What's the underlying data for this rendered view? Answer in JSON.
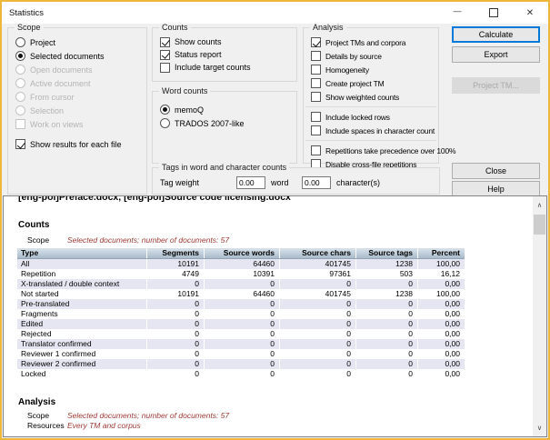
{
  "window": {
    "title": "Statistics"
  },
  "icons": {
    "minimize": "—",
    "close": "✕",
    "scroll_up": "∧",
    "scroll_down": "∨"
  },
  "colors": {
    "window_border": "#ECB73B",
    "titlebar_bg": "#FFFFFF",
    "dialog_bg": "#F0F0F0",
    "focus_border": "#0078D7",
    "table_header_top": "#D9E2EA",
    "table_header_bottom": "#A9BACA",
    "table_alt_row": "#E6E6F2",
    "scope_text_red": "#9E3B35"
  },
  "scope_group": {
    "label": "Scope",
    "options": [
      {
        "type": "radio",
        "label": "Project",
        "checked": false,
        "enabled": true
      },
      {
        "type": "radio",
        "label": "Selected documents",
        "checked": true,
        "enabled": true
      },
      {
        "type": "radio",
        "label": "Open documents",
        "checked": false,
        "enabled": false
      },
      {
        "type": "radio",
        "label": "Active document",
        "checked": false,
        "enabled": false
      },
      {
        "type": "radio",
        "label": "From cursor",
        "checked": false,
        "enabled": false
      },
      {
        "type": "radio",
        "label": "Selection",
        "checked": false,
        "enabled": false
      },
      {
        "type": "checkbox",
        "label": "Work on views",
        "checked": false,
        "enabled": false
      }
    ],
    "footer_options": [
      {
        "type": "checkbox",
        "label": "Show results for each file",
        "checked": true,
        "enabled": true
      }
    ]
  },
  "counts_group": {
    "label": "Counts",
    "items": [
      {
        "type": "checkbox",
        "label": "Show counts",
        "checked": true,
        "enabled": true
      },
      {
        "type": "checkbox",
        "label": "Status report",
        "checked": true,
        "enabled": true
      },
      {
        "type": "checkbox",
        "label": "Include target counts",
        "checked": false,
        "enabled": true
      }
    ]
  },
  "word_counts_group": {
    "label": "Word counts",
    "options": [
      {
        "type": "radio",
        "label": "memoQ",
        "checked": true,
        "enabled": true
      },
      {
        "type": "radio",
        "label": "TRADOS 2007-like",
        "checked": false,
        "enabled": true
      }
    ]
  },
  "analysis_group": {
    "label": "Analysis",
    "block1": [
      {
        "type": "checkbox",
        "label": "Project TMs and corpora",
        "checked": true,
        "enabled": true
      },
      {
        "type": "checkbox",
        "label": "Details by source",
        "checked": false,
        "enabled": true
      },
      {
        "type": "checkbox",
        "label": "Homogeneity",
        "checked": false,
        "enabled": true
      },
      {
        "type": "checkbox",
        "label": "Create project TM",
        "checked": false,
        "enabled": true
      },
      {
        "type": "checkbox",
        "label": "Show weighted counts",
        "checked": false,
        "enabled": true
      }
    ],
    "block2": [
      {
        "type": "checkbox",
        "label": "Include locked rows",
        "checked": false,
        "enabled": true
      },
      {
        "type": "checkbox",
        "label": "Include spaces in character count",
        "checked": false,
        "enabled": true
      }
    ],
    "block3": [
      {
        "type": "checkbox",
        "label": "Repetitions take precedence over 100%",
        "checked": false,
        "enabled": true
      },
      {
        "type": "checkbox",
        "label": "Disable cross-file repetitions",
        "checked": false,
        "enabled": true
      }
    ]
  },
  "tags_group": {
    "label": "Tags in word and character counts",
    "tag_weight_label": "Tag weight",
    "word_value": "0.00",
    "word_label": "word",
    "char_value": "0.00",
    "char_label": "character(s)"
  },
  "buttons": {
    "calculate": "Calculate",
    "export": "Export",
    "project_tm": "Project TM...",
    "close": "Close",
    "help": "Help"
  },
  "results": {
    "file_heading": "[eng-pol]Preface.docx, [eng-pol]Source code licensing.docx",
    "counts_section": {
      "title": "Counts",
      "scope_label": "Scope",
      "scope_value": "Selected documents; number of documents: 57"
    },
    "table": {
      "columns": [
        "Type",
        "Segments",
        "Source words",
        "Source chars",
        "Source tags",
        "Percent"
      ],
      "rows": [
        [
          "All",
          "10191",
          "64460",
          "401745",
          "1238",
          "100,00"
        ],
        [
          "Repetition",
          "4749",
          "10391",
          "97361",
          "503",
          "16,12"
        ],
        [
          "X-translated / double context",
          "0",
          "0",
          "0",
          "0",
          "0,00"
        ],
        [
          "Not started",
          "10191",
          "64460",
          "401745",
          "1238",
          "100,00"
        ],
        [
          "Pre-translated",
          "0",
          "0",
          "0",
          "0",
          "0,00"
        ],
        [
          "Fragments",
          "0",
          "0",
          "0",
          "0",
          "0,00"
        ],
        [
          "Edited",
          "0",
          "0",
          "0",
          "0",
          "0,00"
        ],
        [
          "Rejected",
          "0",
          "0",
          "0",
          "0",
          "0,00"
        ],
        [
          "Translator confirmed",
          "0",
          "0",
          "0",
          "0",
          "0,00"
        ],
        [
          "Reviewer 1 confirmed",
          "0",
          "0",
          "0",
          "0",
          "0,00"
        ],
        [
          "Reviewer 2 confirmed",
          "0",
          "0",
          "0",
          "0",
          "0,00"
        ],
        [
          "Locked",
          "0",
          "0",
          "0",
          "0",
          "0,00"
        ]
      ]
    },
    "analysis_section": {
      "title": "Analysis",
      "scope_label": "Scope",
      "scope_value": "Selected documents; number of documents: 57",
      "resources_label": "Resources",
      "resources_value": "Every TM and corpus"
    }
  }
}
